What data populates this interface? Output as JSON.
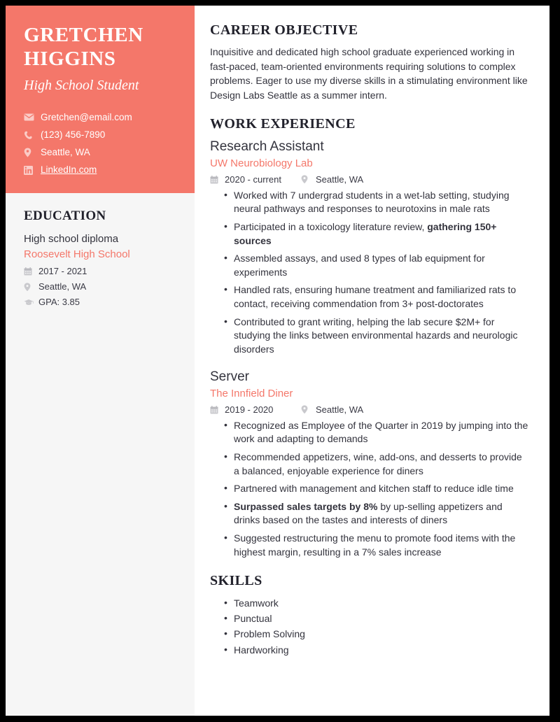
{
  "theme": {
    "accent": "#f4776a",
    "sidebar_bg": "#f6f6f6",
    "text": "#33333d",
    "heading": "#21212b"
  },
  "sidebar": {
    "name": "Gretchen Higgins",
    "job_title": "High School Student",
    "contacts": [
      {
        "icon": "envelope-icon",
        "text": "Gretchen@email.com",
        "is_link": false
      },
      {
        "icon": "phone-icon",
        "text": "(123) 456-7890",
        "is_link": false
      },
      {
        "icon": "map-pin-icon",
        "text": "Seattle, WA",
        "is_link": false
      },
      {
        "icon": "linkedin-icon",
        "text": "LinkedIn.com",
        "is_link": true
      }
    ],
    "education": {
      "heading": "Education",
      "degree": "High school diploma",
      "school": "Roosevelt High School",
      "meta": [
        {
          "icon": "calendar-icon",
          "text": "2017 - 2021"
        },
        {
          "icon": "map-pin-icon",
          "text": "Seattle, WA"
        },
        {
          "icon": "graduation-cap-icon",
          "text": "GPA: 3.85"
        }
      ]
    }
  },
  "main": {
    "objective": {
      "heading": "Career Objective",
      "text": "Inquisitive and dedicated high school graduate experienced working in fast-paced, team-oriented environments requiring solutions to complex problems. Eager to use my diverse skills in a stimulating environment like Design Labs Seattle as a summer intern."
    },
    "work": {
      "heading": "Work Experience",
      "jobs": [
        {
          "role": "Research Assistant",
          "company": "UW Neurobiology Lab",
          "dates": "2020 - current",
          "location": "Seattle, WA",
          "bullets": [
            {
              "pre": "Worked with 7 undergrad students in a wet-lab setting, studying neural pathways and responses to neurotoxins in male rats",
              "bold": "",
              "post": ""
            },
            {
              "pre": "Participated in a toxicology literature review, ",
              "bold": "gathering 150+ sources",
              "post": ""
            },
            {
              "pre": "Assembled assays, and used 8 types of lab equipment for experiments",
              "bold": "",
              "post": ""
            },
            {
              "pre": "Handled rats, ensuring humane treatment and familiarized rats to contact, receiving commendation from 3+ post-doctorates",
              "bold": "",
              "post": ""
            },
            {
              "pre": "Contributed to grant writing, helping the lab secure $2M+ for studying the links between environmental hazards and neurologic disorders",
              "bold": "",
              "post": ""
            }
          ]
        },
        {
          "role": "Server",
          "company": "The Innfield Diner",
          "dates": "2019 - 2020",
          "location": "Seattle, WA",
          "bullets": [
            {
              "pre": "Recognized as Employee of the Quarter in 2019 by jumping into the work and adapting to demands",
              "bold": "",
              "post": ""
            },
            {
              "pre": "Recommended appetizers, wine, add-ons, and desserts to provide a balanced, enjoyable experience for diners",
              "bold": "",
              "post": ""
            },
            {
              "pre": "Partnered with management and kitchen staff to reduce idle time",
              "bold": "",
              "post": ""
            },
            {
              "pre": "",
              "bold": "Surpassed sales targets by 8%",
              "post": " by up-selling appetizers and drinks based on the tastes and interests of diners"
            },
            {
              "pre": "Suggested restructuring the menu to promote food items with the highest margin, resulting in a 7% sales increase",
              "bold": "",
              "post": ""
            }
          ]
        }
      ]
    },
    "skills": {
      "heading": "Skills",
      "items": [
        "Teamwork",
        "Punctual",
        "Problem Solving",
        "Hardworking"
      ]
    }
  }
}
